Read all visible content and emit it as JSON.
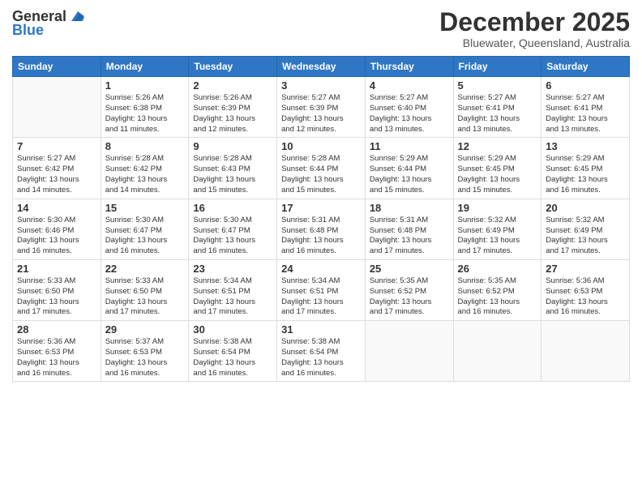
{
  "logo": {
    "general": "General",
    "blue": "Blue"
  },
  "header": {
    "month_year": "December 2025",
    "location": "Bluewater, Queensland, Australia"
  },
  "days_of_week": [
    "Sunday",
    "Monday",
    "Tuesday",
    "Wednesday",
    "Thursday",
    "Friday",
    "Saturday"
  ],
  "weeks": [
    [
      {
        "day": "",
        "info": ""
      },
      {
        "day": "1",
        "info": "Sunrise: 5:26 AM\nSunset: 6:38 PM\nDaylight: 13 hours\nand 11 minutes."
      },
      {
        "day": "2",
        "info": "Sunrise: 5:26 AM\nSunset: 6:39 PM\nDaylight: 13 hours\nand 12 minutes."
      },
      {
        "day": "3",
        "info": "Sunrise: 5:27 AM\nSunset: 6:39 PM\nDaylight: 13 hours\nand 12 minutes."
      },
      {
        "day": "4",
        "info": "Sunrise: 5:27 AM\nSunset: 6:40 PM\nDaylight: 13 hours\nand 13 minutes."
      },
      {
        "day": "5",
        "info": "Sunrise: 5:27 AM\nSunset: 6:41 PM\nDaylight: 13 hours\nand 13 minutes."
      },
      {
        "day": "6",
        "info": "Sunrise: 5:27 AM\nSunset: 6:41 PM\nDaylight: 13 hours\nand 13 minutes."
      }
    ],
    [
      {
        "day": "7",
        "info": "Sunrise: 5:27 AM\nSunset: 6:42 PM\nDaylight: 13 hours\nand 14 minutes."
      },
      {
        "day": "8",
        "info": "Sunrise: 5:28 AM\nSunset: 6:42 PM\nDaylight: 13 hours\nand 14 minutes."
      },
      {
        "day": "9",
        "info": "Sunrise: 5:28 AM\nSunset: 6:43 PM\nDaylight: 13 hours\nand 15 minutes."
      },
      {
        "day": "10",
        "info": "Sunrise: 5:28 AM\nSunset: 6:44 PM\nDaylight: 13 hours\nand 15 minutes."
      },
      {
        "day": "11",
        "info": "Sunrise: 5:29 AM\nSunset: 6:44 PM\nDaylight: 13 hours\nand 15 minutes."
      },
      {
        "day": "12",
        "info": "Sunrise: 5:29 AM\nSunset: 6:45 PM\nDaylight: 13 hours\nand 15 minutes."
      },
      {
        "day": "13",
        "info": "Sunrise: 5:29 AM\nSunset: 6:45 PM\nDaylight: 13 hours\nand 16 minutes."
      }
    ],
    [
      {
        "day": "14",
        "info": "Sunrise: 5:30 AM\nSunset: 6:46 PM\nDaylight: 13 hours\nand 16 minutes."
      },
      {
        "day": "15",
        "info": "Sunrise: 5:30 AM\nSunset: 6:47 PM\nDaylight: 13 hours\nand 16 minutes."
      },
      {
        "day": "16",
        "info": "Sunrise: 5:30 AM\nSunset: 6:47 PM\nDaylight: 13 hours\nand 16 minutes."
      },
      {
        "day": "17",
        "info": "Sunrise: 5:31 AM\nSunset: 6:48 PM\nDaylight: 13 hours\nand 16 minutes."
      },
      {
        "day": "18",
        "info": "Sunrise: 5:31 AM\nSunset: 6:48 PM\nDaylight: 13 hours\nand 17 minutes."
      },
      {
        "day": "19",
        "info": "Sunrise: 5:32 AM\nSunset: 6:49 PM\nDaylight: 13 hours\nand 17 minutes."
      },
      {
        "day": "20",
        "info": "Sunrise: 5:32 AM\nSunset: 6:49 PM\nDaylight: 13 hours\nand 17 minutes."
      }
    ],
    [
      {
        "day": "21",
        "info": "Sunrise: 5:33 AM\nSunset: 6:50 PM\nDaylight: 13 hours\nand 17 minutes."
      },
      {
        "day": "22",
        "info": "Sunrise: 5:33 AM\nSunset: 6:50 PM\nDaylight: 13 hours\nand 17 minutes."
      },
      {
        "day": "23",
        "info": "Sunrise: 5:34 AM\nSunset: 6:51 PM\nDaylight: 13 hours\nand 17 minutes."
      },
      {
        "day": "24",
        "info": "Sunrise: 5:34 AM\nSunset: 6:51 PM\nDaylight: 13 hours\nand 17 minutes."
      },
      {
        "day": "25",
        "info": "Sunrise: 5:35 AM\nSunset: 6:52 PM\nDaylight: 13 hours\nand 17 minutes."
      },
      {
        "day": "26",
        "info": "Sunrise: 5:35 AM\nSunset: 6:52 PM\nDaylight: 13 hours\nand 16 minutes."
      },
      {
        "day": "27",
        "info": "Sunrise: 5:36 AM\nSunset: 6:53 PM\nDaylight: 13 hours\nand 16 minutes."
      }
    ],
    [
      {
        "day": "28",
        "info": "Sunrise: 5:36 AM\nSunset: 6:53 PM\nDaylight: 13 hours\nand 16 minutes."
      },
      {
        "day": "29",
        "info": "Sunrise: 5:37 AM\nSunset: 6:53 PM\nDaylight: 13 hours\nand 16 minutes."
      },
      {
        "day": "30",
        "info": "Sunrise: 5:38 AM\nSunset: 6:54 PM\nDaylight: 13 hours\nand 16 minutes."
      },
      {
        "day": "31",
        "info": "Sunrise: 5:38 AM\nSunset: 6:54 PM\nDaylight: 13 hours\nand 16 minutes."
      },
      {
        "day": "",
        "info": ""
      },
      {
        "day": "",
        "info": ""
      },
      {
        "day": "",
        "info": ""
      }
    ]
  ]
}
